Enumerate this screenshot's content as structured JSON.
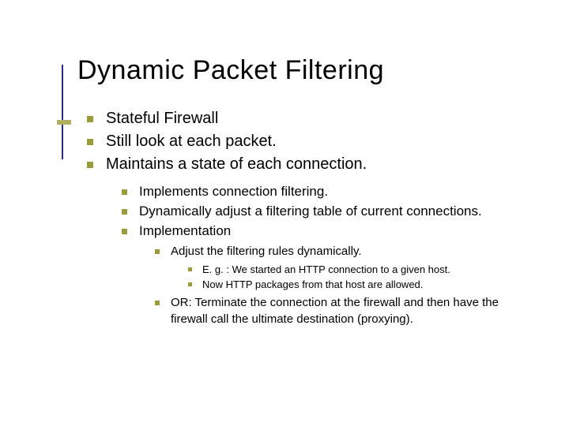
{
  "title": "Dynamic Packet Filtering",
  "lvl1": [
    "Stateful Firewall",
    "Still look at each packet.",
    "Maintains a state of each connection."
  ],
  "lvl2": [
    "Implements connection filtering.",
    "Dynamically adjust a filtering table of current connections.",
    "Implementation"
  ],
  "lvl3": [
    "Adjust the filtering rules dynamically.",
    "OR: Terminate the connection at the firewall and then have the firewall call the ultimate destination (proxying)."
  ],
  "lvl4": [
    "E. g. : We started an HTTP connection to a given host.",
    "Now HTTP packages from that host are allowed."
  ]
}
